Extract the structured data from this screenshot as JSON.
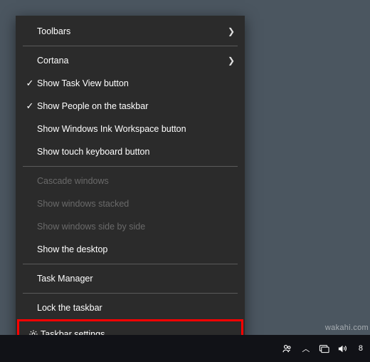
{
  "menu": {
    "toolbars": "Toolbars",
    "cortana": "Cortana",
    "show_task_view": "Show Task View button",
    "show_people": "Show People on the taskbar",
    "show_ink": "Show Windows Ink Workspace button",
    "show_touch_kbd": "Show touch keyboard button",
    "cascade": "Cascade windows",
    "stacked": "Show windows stacked",
    "side_by_side": "Show windows side by side",
    "show_desktop": "Show the desktop",
    "task_manager": "Task Manager",
    "lock_taskbar": "Lock the taskbar",
    "taskbar_settings": "Taskbar settings"
  },
  "tray": {
    "clock_time": "8"
  },
  "watermark": "wakahi.com"
}
